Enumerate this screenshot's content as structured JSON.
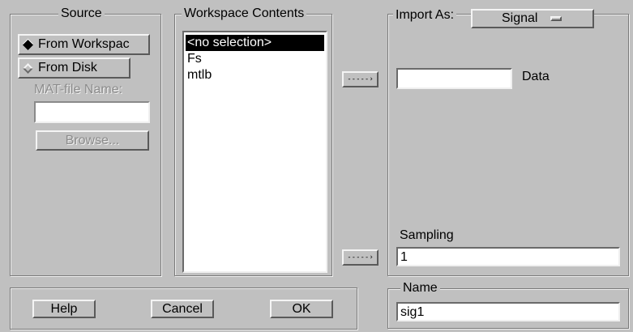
{
  "source": {
    "title": "Source",
    "from_workspace_label": "From Workspac",
    "from_disk_label": "From Disk",
    "selected": "From Workspace",
    "matfile_label": "MAT-file Name:",
    "matfile_value": "",
    "browse_label": "Browse..."
  },
  "workspace": {
    "title": "Workspace Contents",
    "items": [
      "<no selection>",
      "Fs",
      "mtlb"
    ],
    "selected_index": 0
  },
  "transfer": {
    "data_arrow_label": "-----›",
    "sampling_arrow_label": "-----›"
  },
  "import": {
    "title": "Import As:",
    "type_value": "Signal",
    "data_value": "",
    "data_label": "Data",
    "sampling_label": "Sampling",
    "sampling_value": "1"
  },
  "name": {
    "title": "Name",
    "value": "sig1"
  },
  "buttons": {
    "help": "Help",
    "cancel": "Cancel",
    "ok": "OK"
  }
}
